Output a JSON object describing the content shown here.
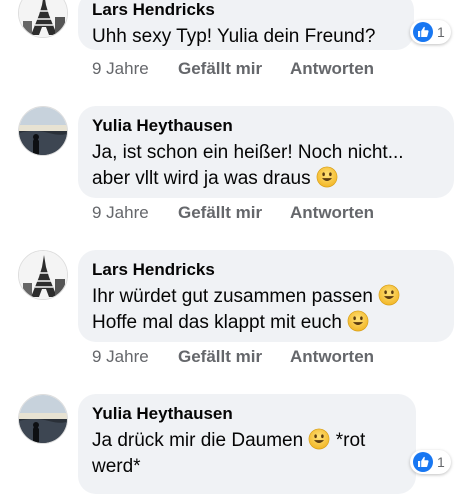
{
  "comments": [
    {
      "author": "Lars Hendricks",
      "lines": [
        "Uhh sexy Typ! Yulia dein Freund?"
      ],
      "time": "9 Jahre",
      "like_label": "Gefällt mir",
      "reply_label": "Antworten",
      "reactions": "1",
      "avatar": "eiffel-tower"
    },
    {
      "author": "Yulia Heythausen",
      "lines": [
        "Ja, ist schon ein heißer! Noch nicht...",
        "aber vllt wird ja was draus"
      ],
      "time": "9 Jahre",
      "like_label": "Gefällt mir",
      "reply_label": "Antworten",
      "avatar": "sunset-person"
    },
    {
      "author": "Lars Hendricks",
      "lines": [
        "Ihr würdet gut zusammen passen",
        "Hoffe mal das klappt mit euch"
      ],
      "time": "9 Jahre",
      "like_label": "Gefällt mir",
      "reply_label": "Antworten",
      "avatar": "eiffel-tower"
    },
    {
      "author": "Yulia Heythausen",
      "lines": [
        "Ja drück mir die Daumen",
        "*rot",
        "werd*"
      ],
      "reactions": "1",
      "avatar": "sunset-person"
    }
  ],
  "icons": {
    "like": "thumbs-up-icon",
    "emoji": "smiley-face-icon"
  },
  "colors": {
    "bubble": "#f0f2f5",
    "meta": "#65676b",
    "like_blue": "#1877f2",
    "emoji_yellow": "#f7c33b"
  }
}
